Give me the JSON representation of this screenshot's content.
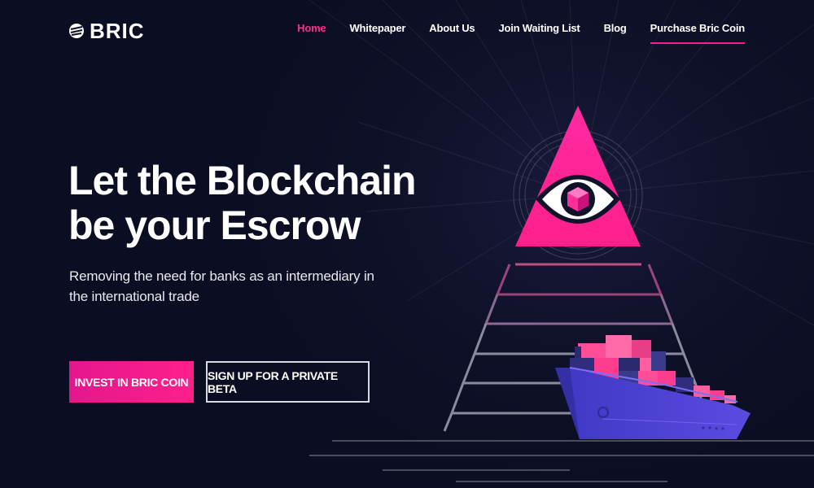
{
  "brand": {
    "name": "BRIC"
  },
  "nav": {
    "items": [
      {
        "label": "Home",
        "active": true
      },
      {
        "label": "Whitepaper"
      },
      {
        "label": "About Us"
      },
      {
        "label": "Join Waiting List"
      },
      {
        "label": "Blog"
      },
      {
        "label": "Purchase Bric Coin",
        "highlighted": true
      }
    ]
  },
  "hero": {
    "title_line1": "Let the Blockchain",
    "title_line2": "be your Escrow",
    "subtitle": "Removing the need for banks as an intermediary in the international trade",
    "primary_button": "INVEST IN BRIC COIN",
    "secondary_button": "SIGN UP FOR A PRIVATE BETA"
  },
  "colors": {
    "background": "#0d0f26",
    "accent": "#ff1b8d",
    "ship_hull": "#4a3fc9",
    "container_pink": "#ff3d8f",
    "container_blue": "#2c2c7a"
  },
  "icons": [
    "bric-logo-icon",
    "all-seeing-eye-icon",
    "cargo-ship-icon"
  ]
}
